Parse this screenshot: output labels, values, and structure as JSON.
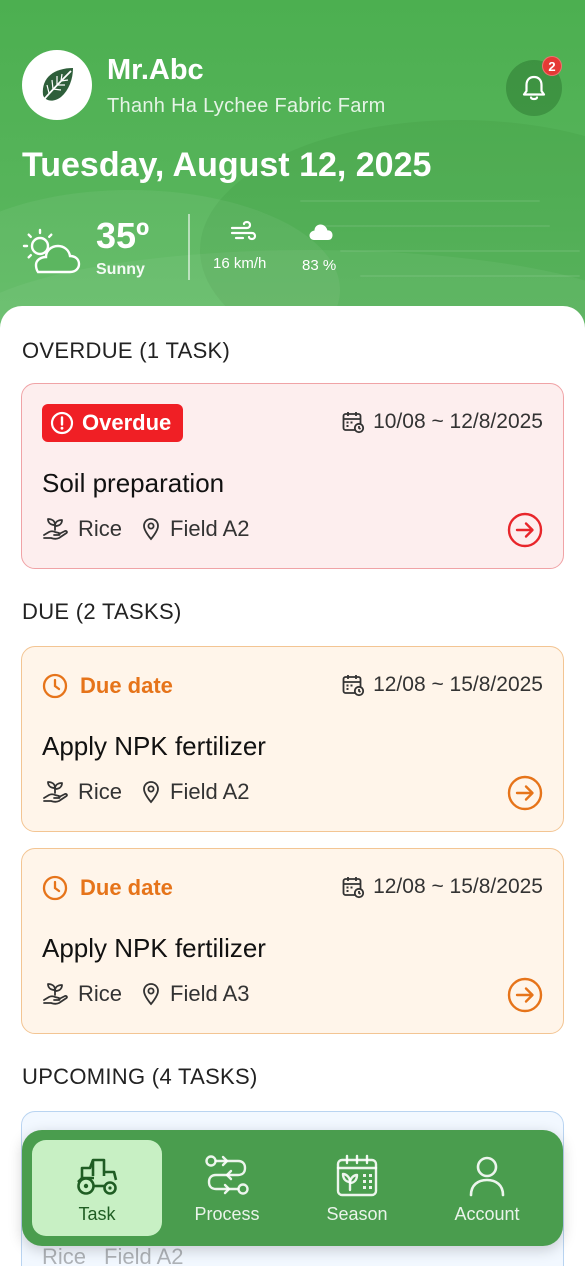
{
  "header": {
    "user_name": "Mr.Abc",
    "farm_name": "Thanh Ha Lychee Fabric Farm",
    "notification_count": "2",
    "date": "Tuesday, August 12, 2025"
  },
  "weather": {
    "temperature": "35º",
    "condition": "Sunny",
    "wind": "16 km/h",
    "humidity": "83 %"
  },
  "sections": {
    "overdue_title": "OVERDUE (1 TASK)",
    "due_title": "DUE (2 TASKS)",
    "upcoming_title": "UPCOMING (4 TASKS)"
  },
  "tasks": {
    "overdue": [
      {
        "status": "Overdue",
        "date_range": "10/08 ~ 12/8/2025",
        "title": "Soil preparation",
        "crop": "Rice",
        "field": "Field A2"
      }
    ],
    "due": [
      {
        "status": "Due date",
        "date_range": "12/08 ~ 15/8/2025",
        "title": "Apply NPK fertilizer",
        "crop": "Rice",
        "field": "Field A2"
      },
      {
        "status": "Due date",
        "date_range": "12/08 ~ 15/8/2025",
        "title": "Apply NPK fertilizer",
        "crop": "Rice",
        "field": "Field A3"
      }
    ],
    "upcoming": [
      {
        "crop": "Rice",
        "field": "Field A2"
      }
    ]
  },
  "nav": {
    "items": [
      {
        "label": "Task",
        "icon": "tractor-icon",
        "active": true
      },
      {
        "label": "Process",
        "icon": "process-icon",
        "active": false
      },
      {
        "label": "Season",
        "icon": "calendar-plant-icon",
        "active": false
      },
      {
        "label": "Account",
        "icon": "user-icon",
        "active": false
      }
    ]
  },
  "colors": {
    "primary_green": "#4caf50",
    "overdue_red": "#f01f25",
    "due_orange": "#e6741a",
    "active_nav_bg": "#c8f0c4"
  }
}
